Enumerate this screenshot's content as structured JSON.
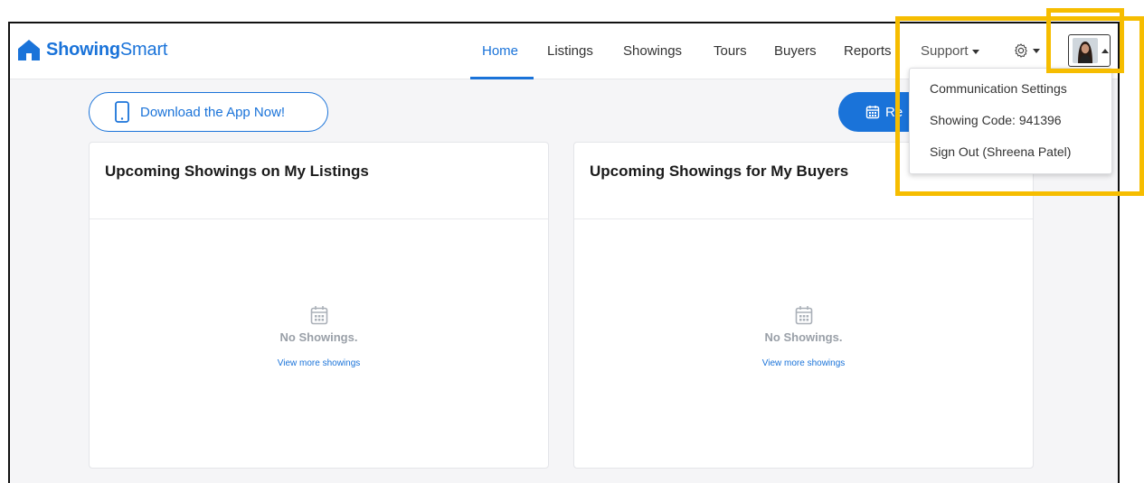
{
  "brand": {
    "name_bold": "Showing",
    "name_light": "Smart",
    "color": "#1a73d9"
  },
  "nav": {
    "home": "Home",
    "listings": "Listings",
    "showings": "Showings",
    "tours": "Tours",
    "buyers": "Buyers",
    "reports": "Reports",
    "support": "Support",
    "active": "Home"
  },
  "actions": {
    "download_app": "Download the App Now!",
    "request_partial": "Re"
  },
  "cards": [
    {
      "title": "Upcoming Showings on My Listings",
      "empty_text": "No Showings.",
      "link": "View more showings"
    },
    {
      "title": "Upcoming Showings for My Buyers",
      "empty_text": "No Showings.",
      "link": "View more showings"
    }
  ],
  "user_menu": {
    "items": [
      "Communication Settings",
      "Showing Code: 941396",
      "Sign Out (Shreena Patel)"
    ]
  },
  "colors": {
    "accent": "#1a73d9",
    "highlight": "#f6bd00",
    "muted": "#9aa0a8"
  },
  "icons": [
    "house-logo-icon",
    "phone-icon",
    "calendar-icon",
    "gear-icon",
    "avatar",
    "chevron-down-icon",
    "chevron-up-icon"
  ]
}
